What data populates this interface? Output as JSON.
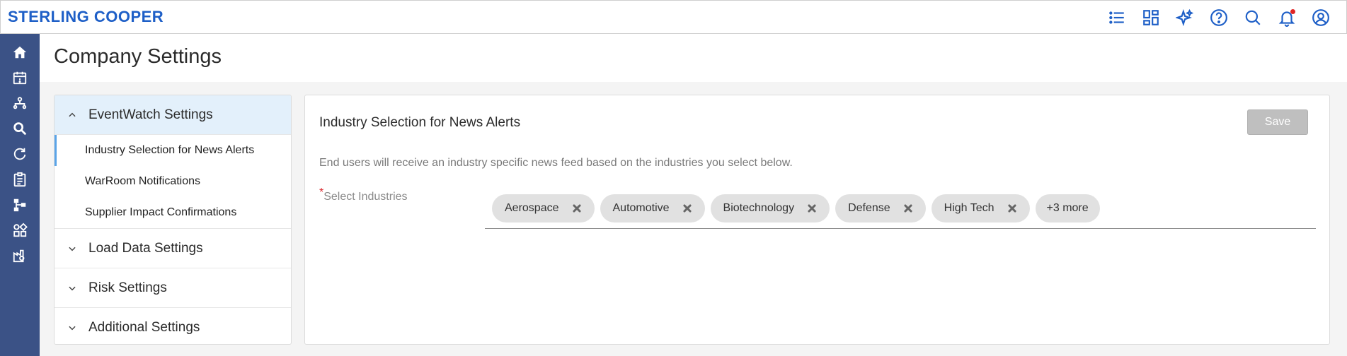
{
  "app": {
    "brand": "STERLING COOPER"
  },
  "topbar": {
    "icons": [
      "list-icon",
      "dashboard-icon",
      "sparkle-icon",
      "help-icon",
      "search-icon",
      "bell-icon",
      "user-icon"
    ]
  },
  "sidenav": {
    "icons": [
      "home-icon",
      "calendar-icon",
      "network-icon",
      "search-zoom-icon",
      "refresh-icon",
      "clipboard-icon",
      "hierarchy-icon",
      "widgets-icon",
      "factory-icon"
    ]
  },
  "page": {
    "title": "Company Settings"
  },
  "settings_menu": {
    "groups": [
      {
        "label": "EventWatch Settings",
        "expanded": true,
        "items": [
          {
            "label": "Industry Selection for News Alerts"
          },
          {
            "label": "WarRoom Notifications"
          },
          {
            "label": "Supplier Impact Confirmations"
          }
        ]
      },
      {
        "label": "Load Data Settings",
        "expanded": false
      },
      {
        "label": "Risk Settings",
        "expanded": false
      },
      {
        "label": "Additional Settings",
        "expanded": false
      }
    ]
  },
  "panel": {
    "title": "Industry Selection for News Alerts",
    "save_label": "Save",
    "description": "End users will receive an industry specific news feed based on the industries you select below.",
    "field_label": "Select Industries",
    "required_mark": "*",
    "chips": [
      "Aerospace",
      "Automotive",
      "Biotechnology",
      "Defense",
      "High Tech"
    ],
    "more_label": "+3 more"
  },
  "colors": {
    "brand": "#1e5fc7",
    "sidenav_bg": "#3b5286",
    "active_menu_bg": "#e3f0fb",
    "save_disabled": "#bfbfbf",
    "notification_dot": "#e02424"
  }
}
